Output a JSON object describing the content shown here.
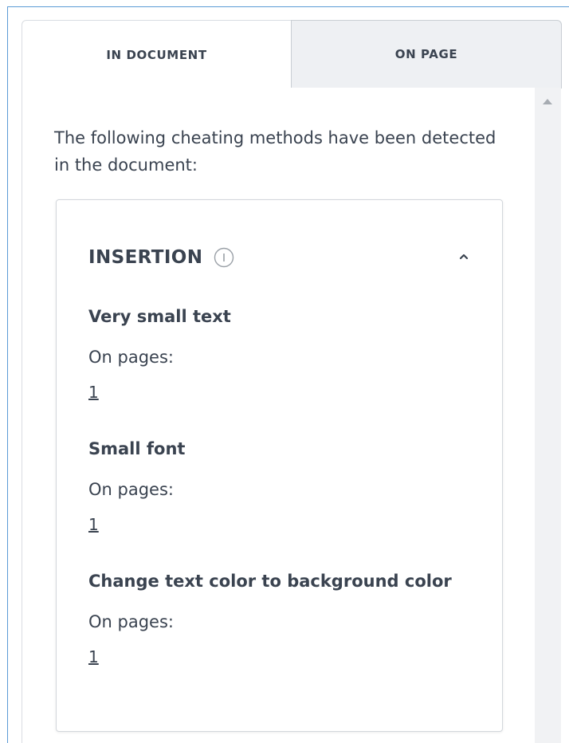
{
  "tabs": [
    {
      "label": "IN DOCUMENT",
      "active": true
    },
    {
      "label": "ON PAGE",
      "active": false
    }
  ],
  "intro": "The following cheating methods have been detected in the document:",
  "section": {
    "title": "INSERTION",
    "info_icon": "info-circle-icon",
    "collapse_icon": "chevron-up-icon",
    "items": [
      {
        "title": "Very small text",
        "pages_label": "On pages:",
        "page": "1"
      },
      {
        "title": "Small font",
        "pages_label": "On pages:",
        "page": "1"
      },
      {
        "title": "Change text color to background color",
        "pages_label": "On pages:",
        "page": "1"
      }
    ]
  },
  "colors": {
    "text": "#3a4350",
    "frame_border": "#5b9bd5",
    "inactive_tab": "#eef0f3",
    "scrollbar": "#f1f2f4"
  }
}
